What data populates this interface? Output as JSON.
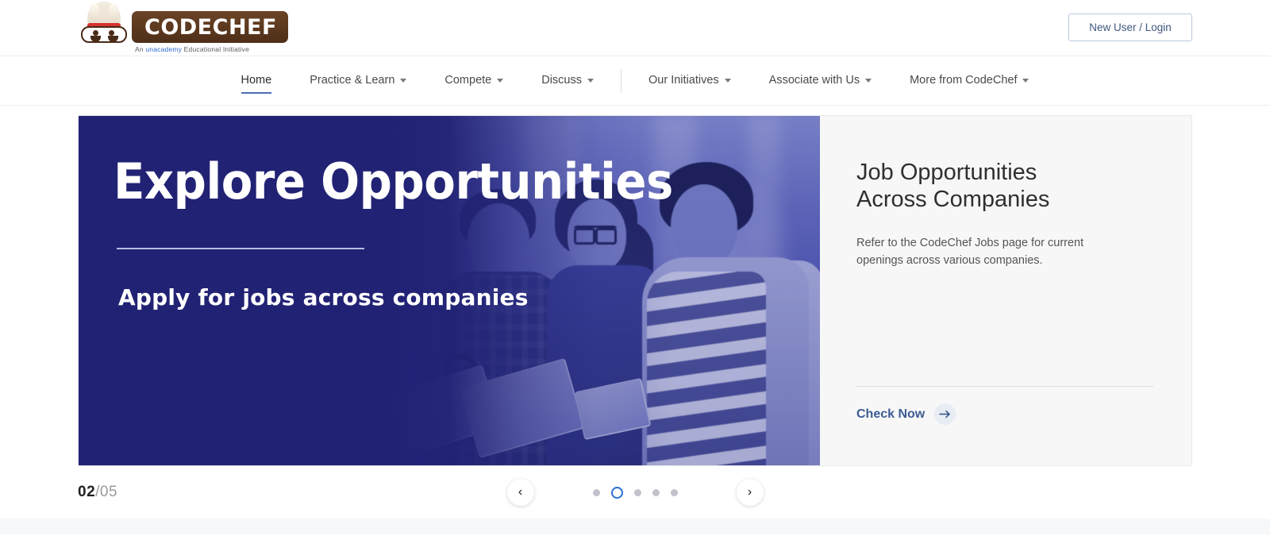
{
  "header": {
    "logo": {
      "name_part1": "CODE",
      "name_part2": "CHEF",
      "tagline_pre": "An ",
      "tagline_brand": "unacademy",
      "tagline_post": " Educational Initiative",
      "chef_icon": "chef-mascot-icon"
    },
    "login_button": "New User / Login"
  },
  "nav": {
    "items": [
      {
        "label": "Home",
        "has_caret": false,
        "active": true
      },
      {
        "label": "Practice & Learn",
        "has_caret": true,
        "active": false
      },
      {
        "label": "Compete",
        "has_caret": true,
        "active": false
      },
      {
        "label": "Discuss",
        "has_caret": true,
        "active": false
      },
      {
        "label": "Our Initiatives",
        "has_caret": true,
        "active": false
      },
      {
        "label": "Associate with Us",
        "has_caret": true,
        "active": false
      },
      {
        "label": "More from CodeChef",
        "has_caret": true,
        "active": false
      }
    ]
  },
  "hero": {
    "banner": {
      "title": "Explore Opportunities",
      "subtitle": "Apply for jobs across companies",
      "image_alt": "three students sitting with tablets duotone blue"
    },
    "panel": {
      "title": "Job Opportunities\nAcross Companies",
      "description": "Refer to the CodeChef Jobs page for current\nopenings across various companies.",
      "cta_label": "Check Now",
      "cta_icon": "arrow-right-icon"
    }
  },
  "carousel": {
    "current": "02",
    "separator": "/",
    "total": "05",
    "prev_icon": "‹",
    "next_icon": "›",
    "dot_count": 5,
    "active_dot_index": 1
  },
  "colors": {
    "navy": "#222275",
    "accent_blue": "#2a6fd6",
    "link_blue": "#3d5c93",
    "panel_bg": "#f7f7f8",
    "nav_underline": "#4a6fb5"
  }
}
